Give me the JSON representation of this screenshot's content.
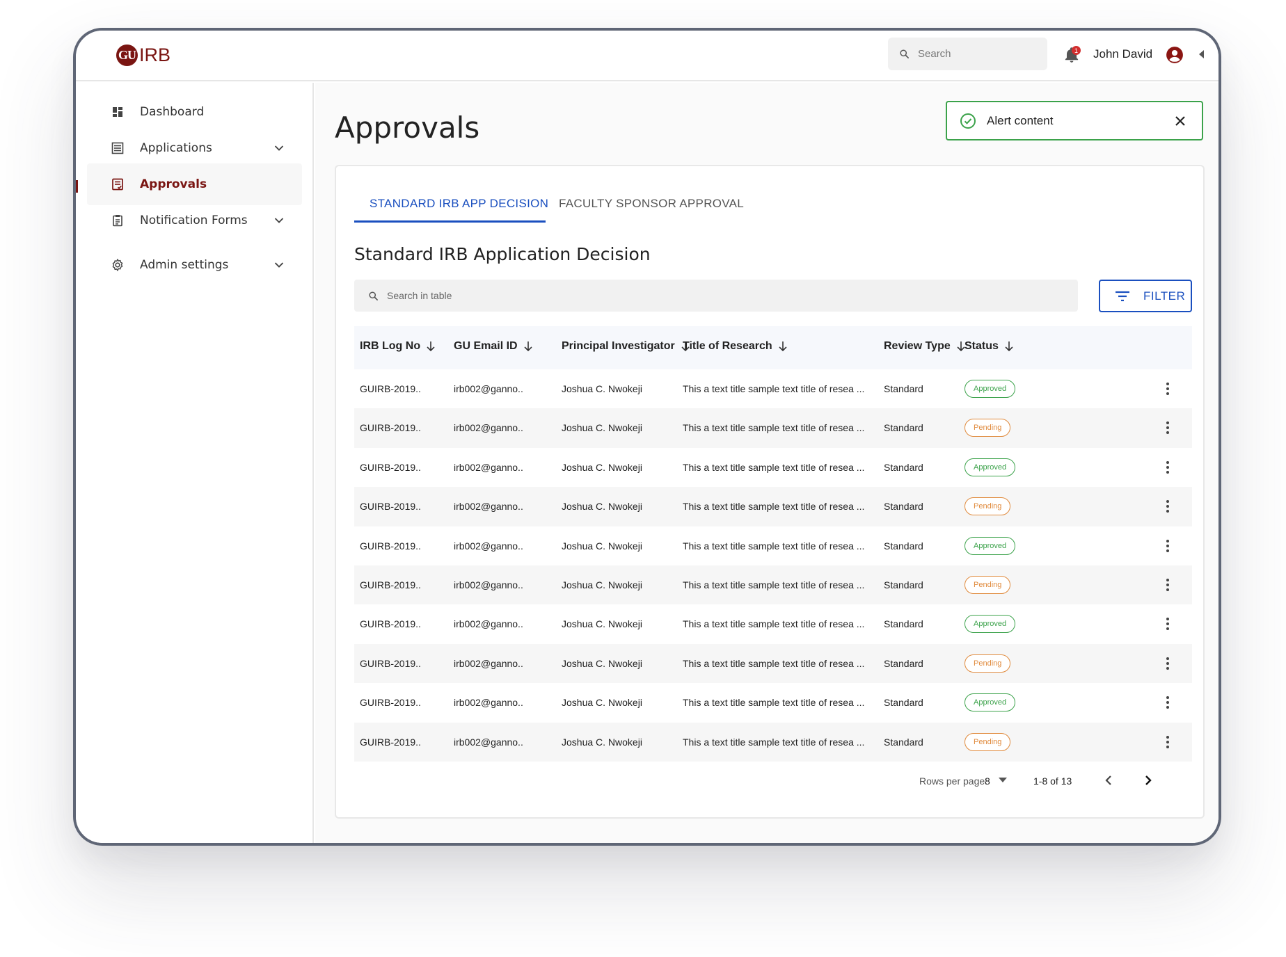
{
  "app": {
    "logo_initials": "GU",
    "logo_text": "IRB",
    "brand_color": "#7a1512",
    "accent_color": "#1a4fbf"
  },
  "topbar": {
    "search_placeholder": "Search",
    "notification_count": "1",
    "user_name": "John David"
  },
  "sidebar": {
    "items": [
      {
        "label": "Dashboard",
        "icon": "dashboard-icon"
      },
      {
        "label": "Applications",
        "icon": "list-icon",
        "expandable": true
      },
      {
        "label": "Approvals",
        "icon": "approvals-icon",
        "active": true
      },
      {
        "label": "Notification Forms",
        "icon": "clipboard-icon",
        "expandable": true
      },
      {
        "label": "Admin settings",
        "icon": "gear-icon",
        "expandable": true
      }
    ]
  },
  "main": {
    "page_title": "Approvals",
    "alert": {
      "text": "Alert content",
      "type": "success"
    },
    "tabs": [
      {
        "label": "STANDARD IRB APP DECISION",
        "active": true
      },
      {
        "label": "FACULTY SPONSOR APPROVAL",
        "active": false
      }
    ],
    "section_title": "Standard IRB Application Decision",
    "table_search_placeholder": "Search in table",
    "filter_label": "FILTER",
    "columns": [
      "IRB Log No",
      "GU Email ID",
      "Principal Investigator",
      "Title of Research",
      "Review Type",
      "Status"
    ],
    "rows": [
      {
        "log": "GUIRB-2019..",
        "email": "irb002@ganno..",
        "pi": "Joshua C. Nwokeji",
        "title": "This a text title sample text title of resea ...",
        "review": "Standard",
        "status": "Approved"
      },
      {
        "log": "GUIRB-2019..",
        "email": "irb002@ganno..",
        "pi": "Joshua C. Nwokeji",
        "title": "This a text title sample text title of resea ...",
        "review": "Standard",
        "status": "Pending"
      },
      {
        "log": "GUIRB-2019..",
        "email": "irb002@ganno..",
        "pi": "Joshua C. Nwokeji",
        "title": "This a text title sample text title of resea ...",
        "review": "Standard",
        "status": "Approved"
      },
      {
        "log": "GUIRB-2019..",
        "email": "irb002@ganno..",
        "pi": "Joshua C. Nwokeji",
        "title": "This a text title sample text title of resea ...",
        "review": "Standard",
        "status": "Pending"
      },
      {
        "log": "GUIRB-2019..",
        "email": "irb002@ganno..",
        "pi": "Joshua C. Nwokeji",
        "title": "This a text title sample text title of resea ...",
        "review": "Standard",
        "status": "Approved"
      },
      {
        "log": "GUIRB-2019..",
        "email": "irb002@ganno..",
        "pi": "Joshua C. Nwokeji",
        "title": "This a text title sample text title of resea ...",
        "review": "Standard",
        "status": "Pending"
      },
      {
        "log": "GUIRB-2019..",
        "email": "irb002@ganno..",
        "pi": "Joshua C. Nwokeji",
        "title": "This a text title sample text title of resea ...",
        "review": "Standard",
        "status": "Approved"
      },
      {
        "log": "GUIRB-2019..",
        "email": "irb002@ganno..",
        "pi": "Joshua C. Nwokeji",
        "title": "This a text title sample text title of resea ...",
        "review": "Standard",
        "status": "Pending"
      },
      {
        "log": "GUIRB-2019..",
        "email": "irb002@ganno..",
        "pi": "Joshua C. Nwokeji",
        "title": "This a text title sample text title of resea ...",
        "review": "Standard",
        "status": "Approved"
      },
      {
        "log": "GUIRB-2019..",
        "email": "irb002@ganno..",
        "pi": "Joshua C. Nwokeji",
        "title": "This a text title sample text title of resea ...",
        "review": "Standard",
        "status": "Pending"
      }
    ],
    "pagination": {
      "rows_per_page_label": "Rows per page:",
      "rows_per_page_value": "8",
      "range_text": "1-8 of 13"
    }
  }
}
